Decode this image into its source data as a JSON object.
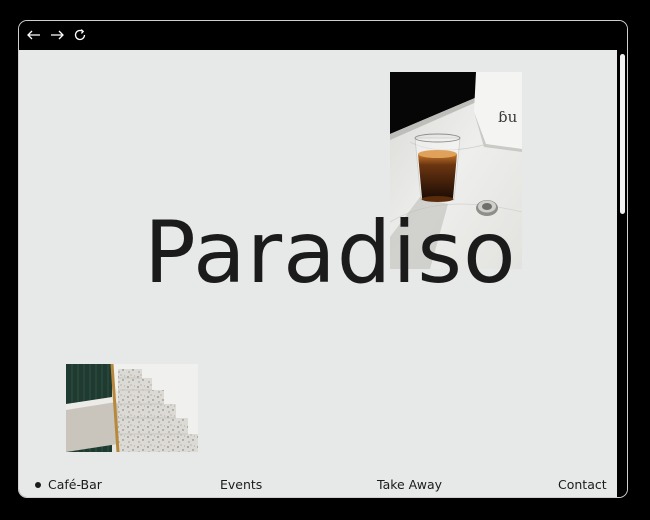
{
  "browser": {
    "back_icon": "arrow-left-icon",
    "forward_icon": "arrow-right-icon",
    "reload_icon": "reload-icon"
  },
  "hero": {
    "title": "Paradiso"
  },
  "images": {
    "coffee": "coffee-glass-on-marble-photo",
    "stairs": "terrazzo-staircase-photo"
  },
  "nav": {
    "items": [
      {
        "label": "Café-Bar",
        "active": true
      },
      {
        "label": "Events",
        "active": false
      },
      {
        "label": "Take Away",
        "active": false
      },
      {
        "label": "Contact",
        "active": false
      }
    ]
  },
  "colors": {
    "page_background": "#e7e9e8",
    "text": "#1b1b1b",
    "chrome": "#000000"
  }
}
